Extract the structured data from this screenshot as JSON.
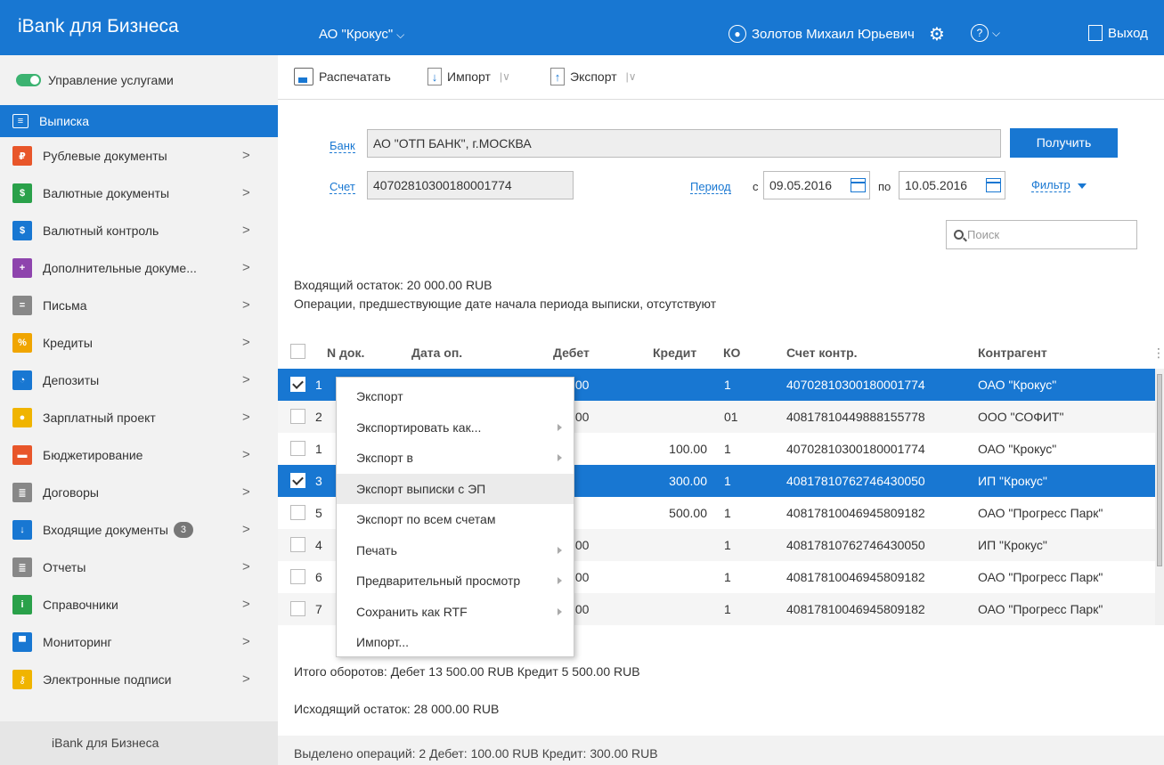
{
  "header": {
    "brand": "iBank для Бизнеса",
    "org": "АО \"Крокус\"",
    "user": "Золотов Михаил Юрьевич",
    "logout": "Выход"
  },
  "sidebar": {
    "toggle_label": "Управление услугами",
    "items": [
      {
        "label": "Выписка",
        "icon": "statement-icon",
        "color": "#ffffff"
      },
      {
        "label": "Рублевые документы",
        "icon": "ruble-docs-icon",
        "color": "#e8562a",
        "glyph": "₽"
      },
      {
        "label": "Валютные документы",
        "icon": "currency-docs-icon",
        "color": "#2aa14a",
        "glyph": "$"
      },
      {
        "label": "Валютный контроль",
        "icon": "currency-control-icon",
        "color": "#1877d2",
        "glyph": "$"
      },
      {
        "label": "Дополнительные докуме...",
        "icon": "additional-docs-icon",
        "color": "#8e44ad",
        "glyph": "+"
      },
      {
        "label": "Письма",
        "icon": "letters-icon",
        "color": "#888888",
        "glyph": "="
      },
      {
        "label": "Кредиты",
        "icon": "credits-icon",
        "color": "#f0a500",
        "glyph": "%"
      },
      {
        "label": "Депозиты",
        "icon": "deposits-icon",
        "color": "#1877d2",
        "glyph": "◔"
      },
      {
        "label": "Зарплатный проект",
        "icon": "salary-icon",
        "color": "#f0b400",
        "glyph": "●"
      },
      {
        "label": "Бюджетирование",
        "icon": "budget-icon",
        "color": "#e8562a",
        "glyph": "▬"
      },
      {
        "label": "Договоры",
        "icon": "contracts-icon",
        "color": "#888888",
        "glyph": "≣"
      },
      {
        "label": "Входящие документы",
        "icon": "incoming-docs-icon",
        "color": "#1877d2",
        "glyph": "↓",
        "badge": "3"
      },
      {
        "label": "Отчеты",
        "icon": "reports-icon",
        "color": "#888888",
        "glyph": "≣"
      },
      {
        "label": "Справочники",
        "icon": "directories-icon",
        "color": "#2aa14a",
        "glyph": "i"
      },
      {
        "label": "Мониторинг",
        "icon": "monitoring-icon",
        "color": "#1877d2",
        "glyph": "▀"
      },
      {
        "label": "Электронные подписи",
        "icon": "key-icon",
        "color": "#f0b400",
        "glyph": "⚷"
      }
    ],
    "footer": "iBank для Бизнеса"
  },
  "toolbar": {
    "print_label": "Распечатать",
    "import_label": "Импорт",
    "export_label": "Экспорт"
  },
  "form": {
    "bank_label": "Банк",
    "bank_value": "АО \"ОТП БАНК\", г.МОСКВА",
    "get_button": "Получить",
    "account_label": "Счет",
    "account_value": "40702810300180001774",
    "period_label": "Период",
    "from_label": "с",
    "date_from": "09.05.2016",
    "to_label": "по",
    "date_to": "10.05.2016",
    "filter_label": "Фильтр",
    "search_placeholder": "Поиск"
  },
  "summary": {
    "opening": "Входящий остаток: 20 000.00 RUB",
    "note": "Операции, предшествующие дате начала периода выписки, отсутствуют",
    "totals": "Итого оборотов: Дебет 13 500.00 RUB Кредит 5 500.00 RUB",
    "closing": "Исходящий остаток: 28 000.00 RUB",
    "status": "Выделено операций: 2 Дебет: 100.00 RUB Кредит: 300.00 RUB"
  },
  "table": {
    "columns": [
      "N док.",
      "Дата оп.",
      "Дебет",
      "Кредит",
      "КО",
      "Счет контр.",
      "Контрагент"
    ],
    "rows": [
      {
        "num": "1",
        "debit": ".00",
        "credit": "",
        "ko": "1",
        "account": "40702810300180001774",
        "party": "ОАО \"Крокус\"",
        "selected": true
      },
      {
        "num": "2",
        "debit": ".00",
        "credit": "",
        "ko": "01",
        "account": "40817810449888155778",
        "party": "ООО \"СОФИТ\"",
        "selected": false
      },
      {
        "num": "1",
        "debit": "",
        "credit": "100.00",
        "ko": "1",
        "account": "40702810300180001774",
        "party": "ОАО \"Крокус\"",
        "selected": false
      },
      {
        "num": "3",
        "debit": "",
        "credit": "300.00",
        "ko": "1",
        "account": "40817810762746430050",
        "party": "ИП \"Крокус\"",
        "selected": true
      },
      {
        "num": "5",
        "debit": "",
        "credit": "500.00",
        "ko": "1",
        "account": "40817810046945809182",
        "party": "ОАО \"Прогресс Парк\"",
        "selected": false
      },
      {
        "num": "4",
        "debit": ".00",
        "credit": "",
        "ko": "1",
        "account": "40817810762746430050",
        "party": "ИП \"Крокус\"",
        "selected": false
      },
      {
        "num": "6",
        "debit": ".00",
        "credit": "",
        "ko": "1",
        "account": "40817810046945809182",
        "party": "ОАО \"Прогресс Парк\"",
        "selected": false
      },
      {
        "num": "7",
        "debit": ".00",
        "credit": "",
        "ko": "1",
        "account": "40817810046945809182",
        "party": "ОАО \"Прогресс Парк\"",
        "selected": false
      }
    ]
  },
  "context_menu": {
    "items": [
      {
        "label": "Экспорт",
        "submenu": false
      },
      {
        "label": "Экспортировать как...",
        "submenu": true
      },
      {
        "label": "Экспорт в",
        "submenu": true
      },
      {
        "label": "Экспорт выписки с ЭП",
        "submenu": false,
        "highlighted": true
      },
      {
        "label": "Экспорт по всем счетам",
        "submenu": false
      },
      {
        "label": "Печать",
        "submenu": true
      },
      {
        "label": "Предварительный просмотр",
        "submenu": true
      },
      {
        "label": "Сохранить как RTF",
        "submenu": true
      },
      {
        "label": "Импорт...",
        "submenu": false
      }
    ]
  },
  "colors": {
    "accent": "#1877d2",
    "sidebar_bg": "#f2f2f2"
  }
}
